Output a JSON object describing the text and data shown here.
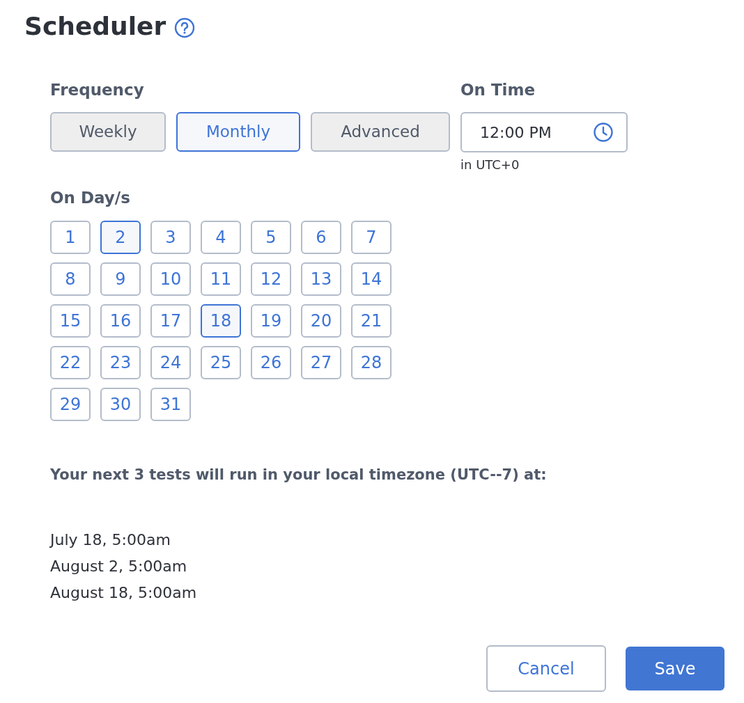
{
  "title": "Scheduler",
  "frequency": {
    "label": "Frequency",
    "options": [
      {
        "label": "Weekly",
        "selected": false
      },
      {
        "label": "Monthly",
        "selected": true
      },
      {
        "label": "Advanced",
        "selected": false
      }
    ]
  },
  "on_time": {
    "label": "On Time",
    "value": "12:00 PM",
    "hint": "in UTC+0"
  },
  "on_days": {
    "label": "On Day/s",
    "days": [
      {
        "label": "1",
        "selected": false
      },
      {
        "label": "2",
        "selected": true
      },
      {
        "label": "3",
        "selected": false
      },
      {
        "label": "4",
        "selected": false
      },
      {
        "label": "5",
        "selected": false
      },
      {
        "label": "6",
        "selected": false
      },
      {
        "label": "7",
        "selected": false
      },
      {
        "label": "8",
        "selected": false
      },
      {
        "label": "9",
        "selected": false
      },
      {
        "label": "10",
        "selected": false
      },
      {
        "label": "11",
        "selected": false
      },
      {
        "label": "12",
        "selected": false
      },
      {
        "label": "13",
        "selected": false
      },
      {
        "label": "14",
        "selected": false
      },
      {
        "label": "15",
        "selected": false
      },
      {
        "label": "16",
        "selected": false
      },
      {
        "label": "17",
        "selected": false
      },
      {
        "label": "18",
        "selected": true
      },
      {
        "label": "19",
        "selected": false
      },
      {
        "label": "20",
        "selected": false
      },
      {
        "label": "21",
        "selected": false
      },
      {
        "label": "22",
        "selected": false
      },
      {
        "label": "23",
        "selected": false
      },
      {
        "label": "24",
        "selected": false
      },
      {
        "label": "25",
        "selected": false
      },
      {
        "label": "26",
        "selected": false
      },
      {
        "label": "27",
        "selected": false
      },
      {
        "label": "28",
        "selected": false
      },
      {
        "label": "29",
        "selected": false
      },
      {
        "label": "30",
        "selected": false
      },
      {
        "label": "31",
        "selected": false
      }
    ]
  },
  "next_runs": {
    "heading": "Your next 3 tests will run in your local timezone (UTC--7) at:",
    "dates": [
      "July 18, 5:00am",
      "August 2, 5:00am",
      "August 18, 5:00am"
    ]
  },
  "buttons": [
    {
      "label": "Cancel",
      "kind": "secondary"
    },
    {
      "label": "Save",
      "kind": "primary"
    }
  ]
}
